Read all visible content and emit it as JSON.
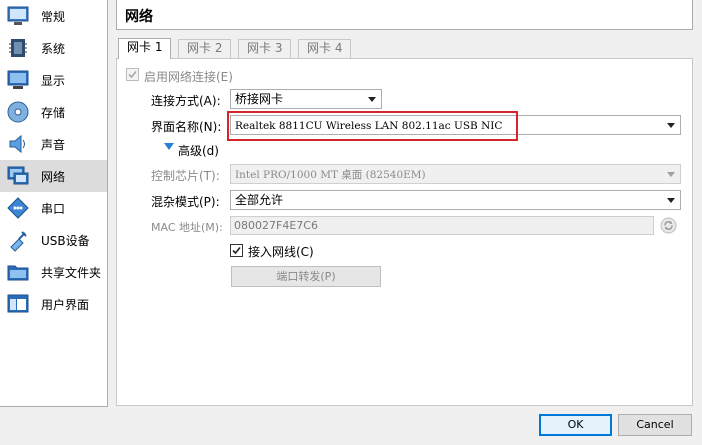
{
  "sidebar": {
    "items": [
      {
        "label": "常规"
      },
      {
        "label": "系统"
      },
      {
        "label": "显示"
      },
      {
        "label": "存储"
      },
      {
        "label": "声音"
      },
      {
        "label": "网络"
      },
      {
        "label": "串口"
      },
      {
        "label": "USB设备"
      },
      {
        "label": "共享文件夹"
      },
      {
        "label": "用户界面"
      }
    ],
    "selected": "网络"
  },
  "header": {
    "title": "网络"
  },
  "tabs": [
    {
      "label": "网卡 1"
    },
    {
      "label": "网卡 2"
    },
    {
      "label": "网卡 3"
    },
    {
      "label": "网卡 4"
    }
  ],
  "adapter": {
    "enable_label": "启用网络连接(E)",
    "attached_label": "连接方式(A):",
    "attached_value": "桥接网卡",
    "name_label": "界面名称(N):",
    "name_value": "Realtek 8811CU Wireless LAN 802.11ac USB NIC",
    "advanced_label": "高级(d)",
    "adapter_type_label": "控制芯片(T):",
    "adapter_type_value": "Intel PRO/1000 MT 桌面 (82540EM)",
    "promiscuous_label": "混杂模式(P):",
    "promiscuous_value": "全部允许",
    "mac_label": "MAC 地址(M):",
    "mac_value": "080027F4E7C6",
    "cable_label": "接入网线(C)",
    "port_forward_label": "端口转发(P)"
  },
  "buttons": {
    "ok": "OK",
    "cancel": "Cancel"
  },
  "colors": {
    "highlight": "#d6262b",
    "selected_bg": "#dcdcdc",
    "accent": "#0078d7"
  }
}
